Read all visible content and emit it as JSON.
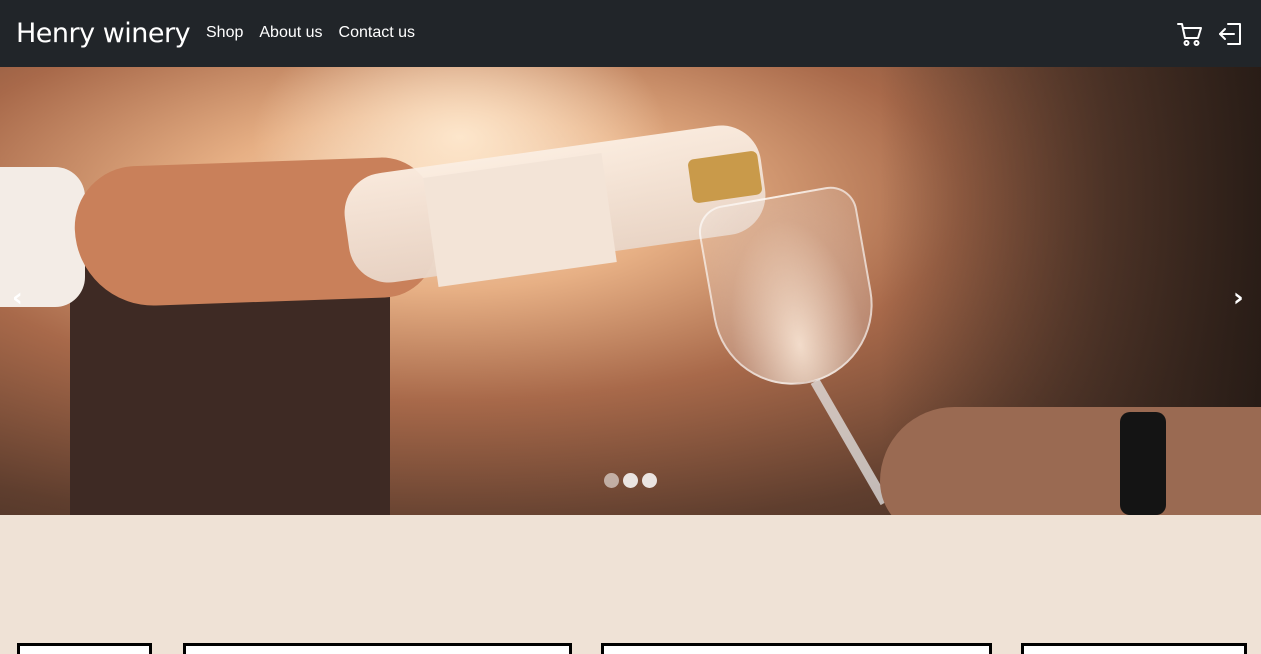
{
  "navbar": {
    "brand": "Henry winery",
    "links": [
      "Shop",
      "About us",
      "Contact us"
    ],
    "icons": {
      "cart": "cart-icon",
      "login": "login-icon"
    },
    "background": "#212529"
  },
  "hero": {
    "prev_label": "‹",
    "next_label": "›",
    "slide_count": 3,
    "active_slide": 1
  },
  "colors": {
    "page_bg": "#efe2d6",
    "nav_text": "#ffffff"
  }
}
